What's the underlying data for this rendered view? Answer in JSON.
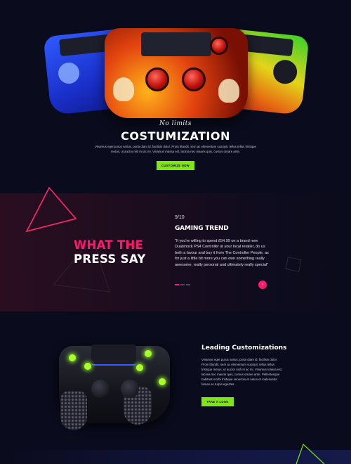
{
  "hero": {
    "tagline": "No limits",
    "title": "COSTUMIZATION",
    "text": "Vivamus eget purus varius, porta diam id, facilisis dolor. Proin blandit, sem ac elementum suscipit, tellus tellus tristique metus, ut auctor nisl mi ac mi. Vivamus massa est, lacinia nec mauris quis, cursus ornare ante.",
    "button": "CUSTOMIZE NOW"
  },
  "press": {
    "heading_line1": "WHAT THE",
    "heading_line2": "PRESS SAY",
    "rating": "9/10",
    "review_title": "GAMING TREND",
    "quote": "\"If you're willing to spend £54.99 on a brand new Dualshock PS4 Controller at your local retailer, do us both a favour and buy it from The Controller People, as for just a little bit more you can own something really awesome, really personal and ultimately really special\"",
    "next_icon": "arrow-right-icon",
    "slides": 3,
    "active_slide": 1
  },
  "customization": {
    "title": "Leading Customizations",
    "text": "Vivamus eget purus varius, porta diam id, facilisis dolor. Proin blandit, sem ac elementum suscipit, tellus tellus tristique metus, ut auctor nisl mi ac mi. Vivamus massa est, lacinia nec mauris quis, cursus ornare ante. Pellentesque habitant morbi tristique senectus et netus et malesuada fames ac turpis egestas.",
    "button": "TAKE A LOOK"
  },
  "colors": {
    "background": "#0a0b1c",
    "accent_pink": "#ff1a6b",
    "accent_green": "#7ee612"
  }
}
